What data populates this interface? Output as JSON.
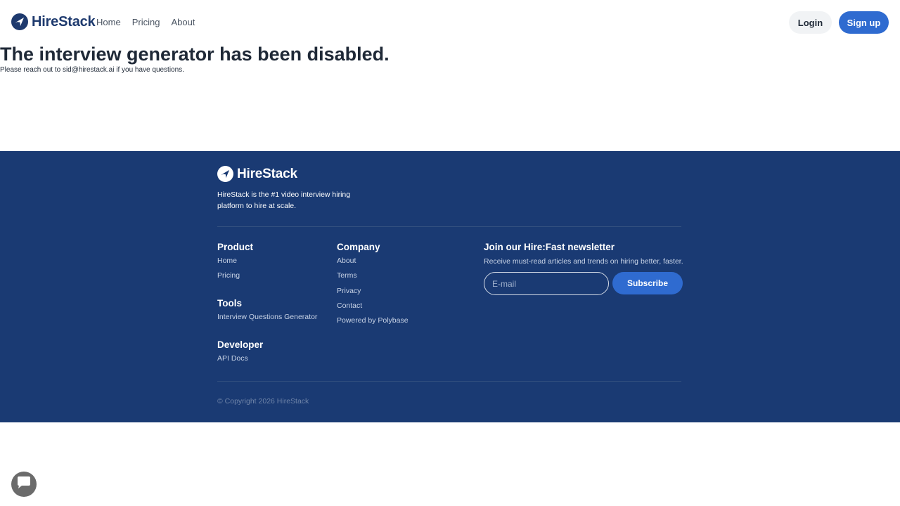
{
  "header": {
    "brand": "HireStack",
    "nav": [
      "Home",
      "Pricing",
      "About"
    ],
    "login_label": "Login",
    "signup_label": "Sign up"
  },
  "main": {
    "title": "The interview generator has been disabled.",
    "subtitle": "Please reach out to sid@hirestack.ai if you have questions."
  },
  "footer": {
    "brand": "HireStack",
    "tagline": "HireStack is the #1 video interview hiring platform to hire at scale.",
    "product": {
      "heading": "Product",
      "links": [
        "Home",
        "Pricing"
      ]
    },
    "tools": {
      "heading": "Tools",
      "links": [
        "Interview Questions Generator"
      ]
    },
    "developer": {
      "heading": "Developer",
      "links": [
        "API Docs"
      ]
    },
    "company": {
      "heading": "Company",
      "links": [
        "About",
        "Terms",
        "Privacy",
        "Contact",
        "Powered by Polybase"
      ]
    },
    "newsletter": {
      "title": "Join our Hire:Fast newsletter",
      "description": "Receive must-read articles and trends on hiring better, faster.",
      "email_placeholder": "E-mail",
      "subscribe_label": "Subscribe"
    },
    "copyright": "© Copyright 2026 HireStack"
  },
  "colors": {
    "brand_navy": "#1e3a6e",
    "footer_bg": "#1a3a73",
    "accent_blue": "#2f6bd0"
  },
  "icons": [
    "logo-plane-icon",
    "chat-bubble-icon"
  ]
}
